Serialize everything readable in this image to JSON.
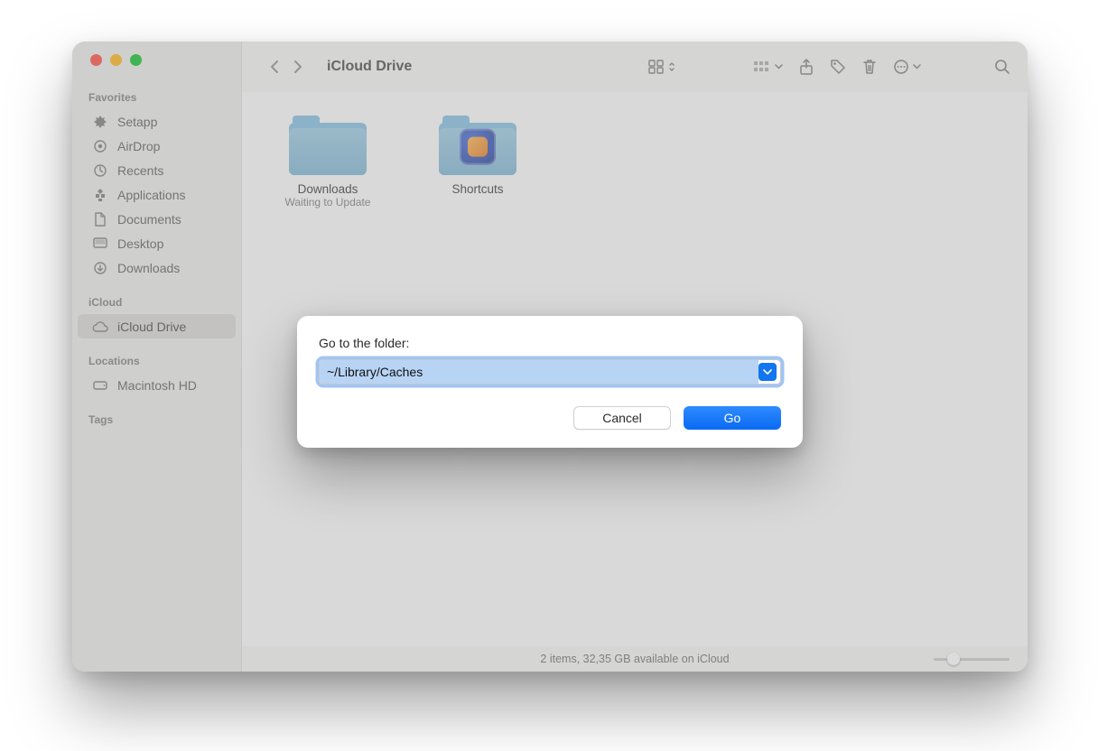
{
  "window_title": "iCloud Drive",
  "sidebar": {
    "sections": [
      {
        "title": "Favorites",
        "items": [
          {
            "label": "Setapp",
            "icon": "setapp-icon"
          },
          {
            "label": "AirDrop",
            "icon": "airdrop-icon"
          },
          {
            "label": "Recents",
            "icon": "clock-icon"
          },
          {
            "label": "Applications",
            "icon": "apps-icon"
          },
          {
            "label": "Documents",
            "icon": "document-icon"
          },
          {
            "label": "Desktop",
            "icon": "desktop-icon"
          },
          {
            "label": "Downloads",
            "icon": "download-icon"
          }
        ]
      },
      {
        "title": "iCloud",
        "items": [
          {
            "label": "iCloud Drive",
            "icon": "cloud-icon",
            "active": true
          }
        ]
      },
      {
        "title": "Locations",
        "items": [
          {
            "label": "Macintosh HD",
            "icon": "disk-icon"
          }
        ]
      },
      {
        "title": "Tags",
        "items": []
      }
    ]
  },
  "content": {
    "items": [
      {
        "label": "Downloads",
        "sub": "Waiting to Update",
        "icon": "folder"
      },
      {
        "label": "Shortcuts",
        "sub": "",
        "icon": "folder-app"
      }
    ]
  },
  "statusbar": "2 items, 32,35 GB available on iCloud",
  "modal": {
    "label": "Go to the folder:",
    "value": "~/Library/Caches",
    "cancel": "Cancel",
    "go": "Go"
  }
}
